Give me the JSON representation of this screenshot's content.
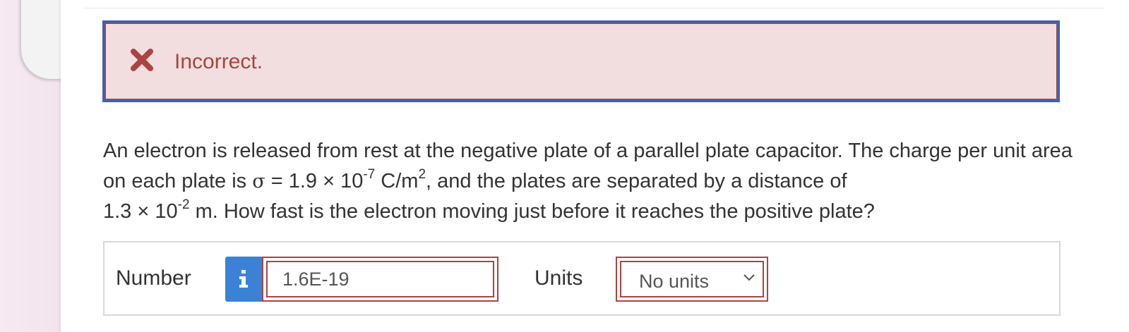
{
  "feedback": {
    "status_icon": "close-icon",
    "message": "Incorrect.",
    "colors": {
      "text": "#a94442",
      "background": "#f2dede",
      "focus_ring": "#2a66c9"
    }
  },
  "question": {
    "part1": "An electron is released from rest at the negative plate of a parallel plate capacitor. The charge per unit area on each plate is ",
    "sigma_symbol": "σ",
    "equals": " = ",
    "sigma_value": "1.9 × 10",
    "sigma_exponent": "-7",
    "sigma_unit": " C/m",
    "sigma_unit_exponent": "2",
    "part2": ", and the plates are separated by a distance of ",
    "distance_value": "1.3 × 10",
    "distance_exponent": "-2",
    "part3": " m. How fast is the electron moving just before it reaches the positive plate?"
  },
  "answer": {
    "number_label": "Number",
    "info_icon": "info-icon",
    "number_value": "1.6E-19",
    "units_label": "Units",
    "units_selected": "No units",
    "units_icon": "chevron-down-icon"
  }
}
